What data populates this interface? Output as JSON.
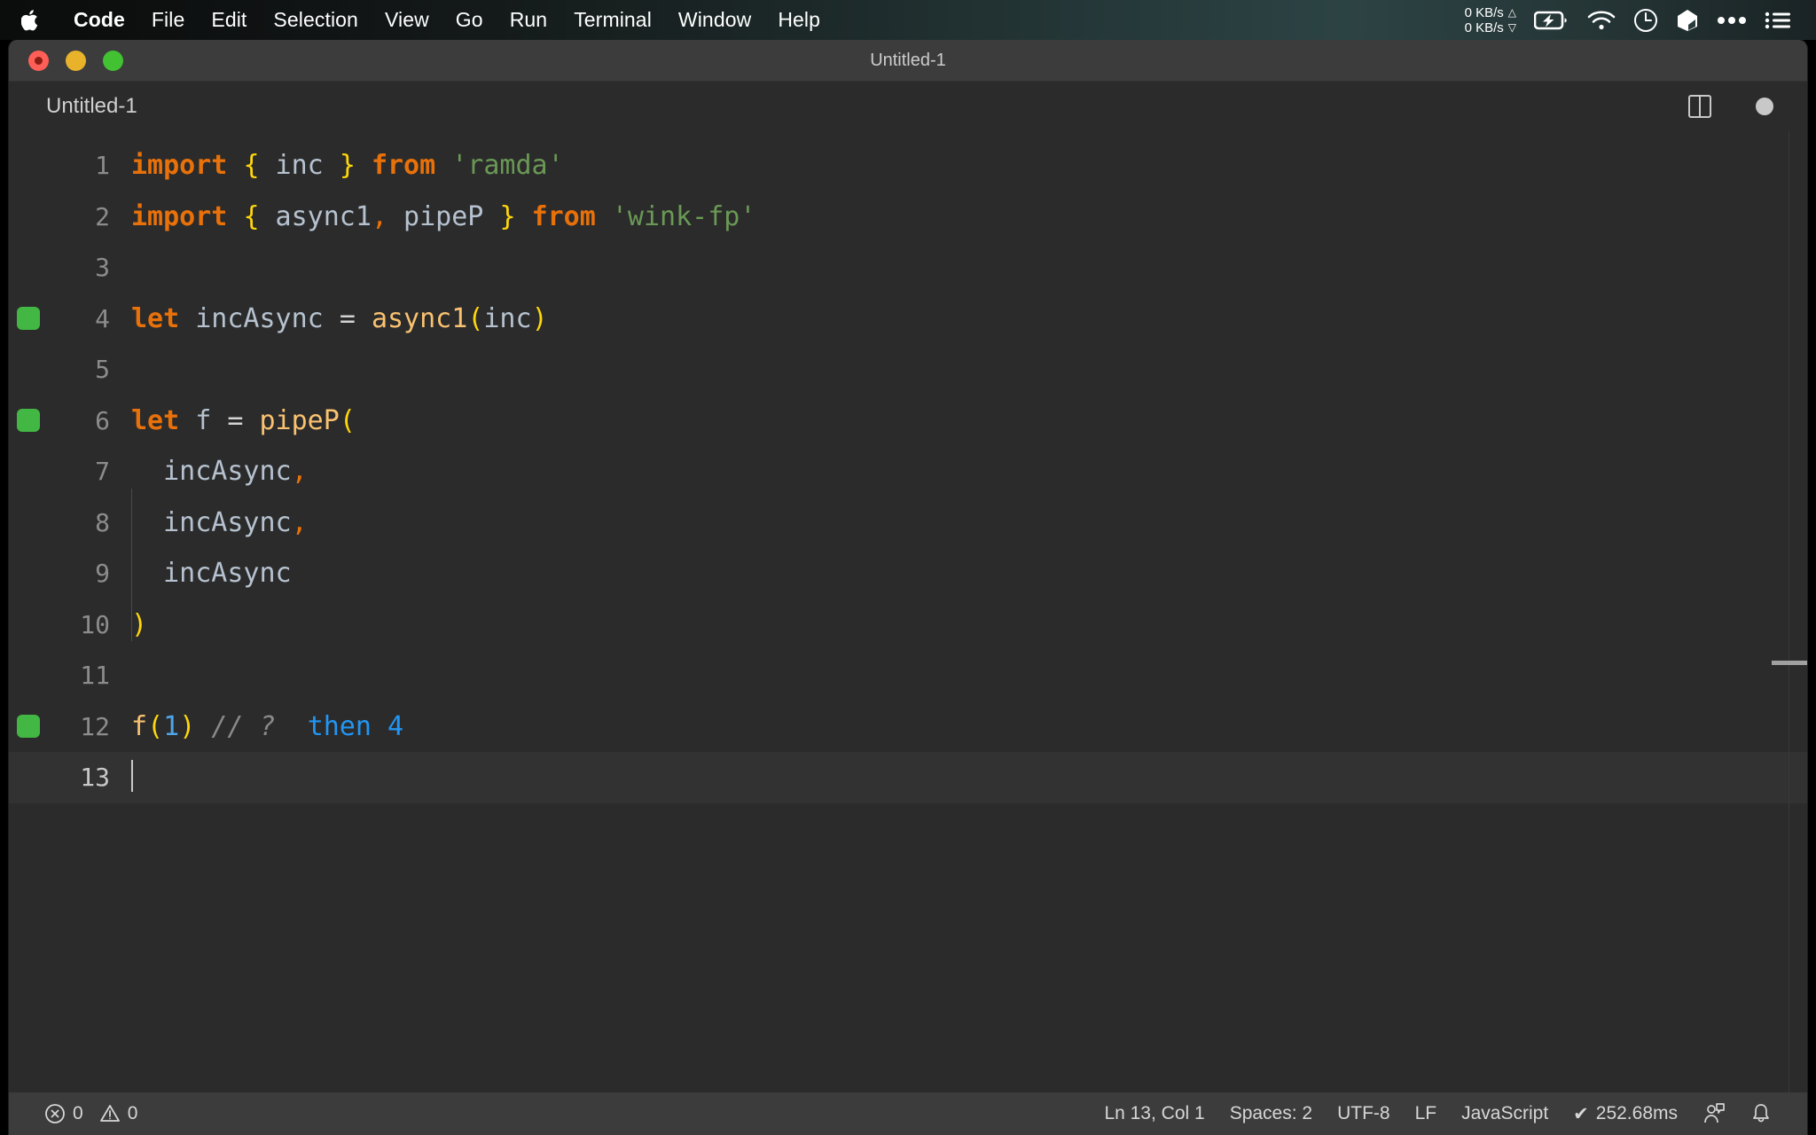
{
  "menubar": {
    "apple_icon": "apple-logo-icon",
    "items": [
      {
        "label": "Code",
        "bold": true
      },
      {
        "label": "File"
      },
      {
        "label": "Edit"
      },
      {
        "label": "Selection"
      },
      {
        "label": "View"
      },
      {
        "label": "Go"
      },
      {
        "label": "Run"
      },
      {
        "label": "Terminal"
      },
      {
        "label": "Window"
      },
      {
        "label": "Help"
      }
    ],
    "network": {
      "upload": "0 KB/s",
      "download": "0 KB/s",
      "up_arrow": "△",
      "down_arrow": "▽"
    },
    "tray": [
      {
        "name": "battery-charging-icon"
      },
      {
        "name": "wifi-icon"
      },
      {
        "name": "clock-icon"
      },
      {
        "name": "dropbox-icon"
      },
      {
        "name": "more-dots-icon"
      },
      {
        "name": "control-center-icon"
      }
    ]
  },
  "window": {
    "title": "Untitled-1",
    "traffic_lights": [
      {
        "name": "close-button",
        "color": "#ff5f57"
      },
      {
        "name": "minimize-button",
        "color": "#e8b32a"
      },
      {
        "name": "maximize-button",
        "color": "#42c132"
      }
    ]
  },
  "tabbar": {
    "tab_label": "Untitled-1",
    "split_icon": "split-editor-icon",
    "dirty_icon": "unsaved-dot-icon"
  },
  "editor": {
    "language": "JavaScript",
    "lines": [
      {
        "number": "1",
        "marker": false,
        "tokens": [
          {
            "t": "import",
            "c": "tk-key"
          },
          {
            "t": " ",
            "c": "tk-op"
          },
          {
            "t": "{",
            "c": "tk-brace"
          },
          {
            "t": " inc ",
            "c": "tk-id"
          },
          {
            "t": "}",
            "c": "tk-brace"
          },
          {
            "t": " ",
            "c": "tk-op"
          },
          {
            "t": "from",
            "c": "tk-key"
          },
          {
            "t": " ",
            "c": "tk-op"
          },
          {
            "t": "'ramda'",
            "c": "tk-str"
          }
        ]
      },
      {
        "number": "2",
        "marker": false,
        "tokens": [
          {
            "t": "import",
            "c": "tk-key"
          },
          {
            "t": " ",
            "c": "tk-op"
          },
          {
            "t": "{",
            "c": "tk-brace"
          },
          {
            "t": " async1",
            "c": "tk-id"
          },
          {
            "t": ",",
            "c": "tk-punct"
          },
          {
            "t": " pipeP ",
            "c": "tk-id"
          },
          {
            "t": "}",
            "c": "tk-brace"
          },
          {
            "t": " ",
            "c": "tk-op"
          },
          {
            "t": "from",
            "c": "tk-key"
          },
          {
            "t": " ",
            "c": "tk-op"
          },
          {
            "t": "'wink-fp'",
            "c": "tk-str"
          }
        ]
      },
      {
        "number": "3",
        "marker": false,
        "tokens": []
      },
      {
        "number": "4",
        "marker": true,
        "tokens": [
          {
            "t": "let",
            "c": "tk-key"
          },
          {
            "t": " incAsync ",
            "c": "tk-id"
          },
          {
            "t": "=",
            "c": "tk-op"
          },
          {
            "t": " ",
            "c": "tk-op"
          },
          {
            "t": "async1",
            "c": "tk-fn"
          },
          {
            "t": "(",
            "c": "tk-brace"
          },
          {
            "t": "inc",
            "c": "tk-id"
          },
          {
            "t": ")",
            "c": "tk-brace"
          }
        ]
      },
      {
        "number": "5",
        "marker": false,
        "tokens": []
      },
      {
        "number": "6",
        "marker": true,
        "tokens": [
          {
            "t": "let",
            "c": "tk-key"
          },
          {
            "t": " f ",
            "c": "tk-id"
          },
          {
            "t": "=",
            "c": "tk-op"
          },
          {
            "t": " ",
            "c": "tk-op"
          },
          {
            "t": "pipeP",
            "c": "tk-fn"
          },
          {
            "t": "(",
            "c": "tk-brace"
          }
        ]
      },
      {
        "number": "7",
        "marker": false,
        "tokens": [
          {
            "t": "  incAsync",
            "c": "tk-id"
          },
          {
            "t": ",",
            "c": "tk-punct"
          }
        ]
      },
      {
        "number": "8",
        "marker": false,
        "tokens": [
          {
            "t": "  incAsync",
            "c": "tk-id"
          },
          {
            "t": ",",
            "c": "tk-punct"
          }
        ]
      },
      {
        "number": "9",
        "marker": false,
        "tokens": [
          {
            "t": "  incAsync",
            "c": "tk-id"
          }
        ]
      },
      {
        "number": "10",
        "marker": false,
        "tokens": [
          {
            "t": ")",
            "c": "tk-brace"
          }
        ]
      },
      {
        "number": "11",
        "marker": false,
        "tokens": []
      },
      {
        "number": "12",
        "marker": true,
        "tokens": [
          {
            "t": "f",
            "c": "tk-fn"
          },
          {
            "t": "(",
            "c": "tk-brace"
          },
          {
            "t": "1",
            "c": "tk-num"
          },
          {
            "t": ")",
            "c": "tk-brace"
          },
          {
            "t": " ",
            "c": "tk-op"
          },
          {
            "t": "// ?",
            "c": "tk-com"
          },
          {
            "t": "  ",
            "c": "tk-op"
          },
          {
            "t": "then 4",
            "c": "tk-res"
          }
        ]
      },
      {
        "number": "13",
        "marker": false,
        "current": true,
        "tokens": []
      }
    ]
  },
  "statusbar": {
    "errors_icon": "error-circle-icon",
    "errors": "0",
    "warnings_icon": "warning-triangle-icon",
    "warnings": "0",
    "cursor_position": "Ln 13, Col 1",
    "indentation": "Spaces: 2",
    "encoding": "UTF-8",
    "eol": "LF",
    "language": "JavaScript",
    "run_check": "✔",
    "run_time": "252.68ms",
    "feedback_icon": "feedback-person-icon",
    "bell_icon": "notifications-bell-icon"
  },
  "colors": {
    "editor_bg": "#2b2b2b",
    "current_line_bg": "#323232",
    "chrome_bg": "#3c3c3c",
    "keyword": "#e8710a",
    "brace": "#ffd60a",
    "identifier": "#b6c2cf",
    "string": "#6a9955",
    "function": "#f9c270",
    "number": "#4fa6e8",
    "comment": "#8a8a8a",
    "result": "#2196f3",
    "run_marker": "#42b743"
  }
}
